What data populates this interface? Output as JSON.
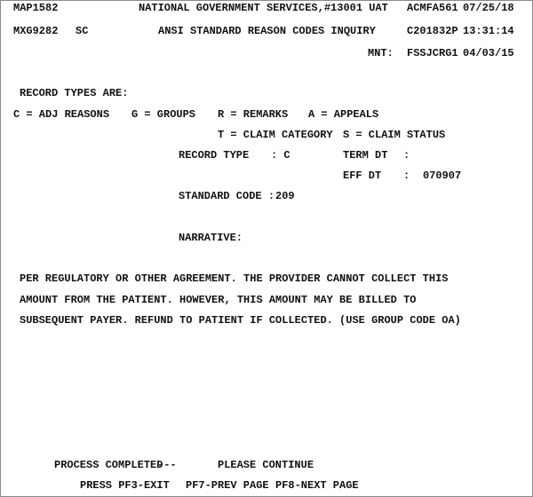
{
  "header": {
    "map_id": "MAP1582",
    "system_title": "NATIONAL GOVERNMENT SERVICES,#13001 UAT",
    "terminal_id": "ACMFA561",
    "date": "07/25/18",
    "screen_id": "MXG9282",
    "screen_code": "SC",
    "screen_title": "ANSI STANDARD REASON CODES INQUIRY",
    "operator_id": "C201832P",
    "time": "13:31:14",
    "mnt_label": "MNT:",
    "mnt_user": "FSSJCRG1",
    "mnt_date": "04/03/15"
  },
  "record_types": {
    "heading": "RECORD TYPES ARE:",
    "c": "C = ADJ REASONS",
    "g": "G = GROUPS",
    "r": "R = REMARKS",
    "a": "A = APPEALS",
    "t": "T = CLAIM CATEGORY",
    "s": "S = CLAIM STATUS"
  },
  "fields": {
    "record_type_label": "RECORD TYPE",
    "record_type_value": ": C",
    "term_dt_label": "TERM DT",
    "term_dt_sep": ":",
    "term_dt_value": "",
    "eff_dt_label": "EFF DT",
    "eff_dt_sep": ":",
    "eff_dt_value": "070907",
    "standard_code_label": "STANDARD CODE :",
    "standard_code_value": "209",
    "narrative_label": "NARRATIVE:"
  },
  "narrative": [
    "PER REGULATORY OR OTHER AGREEMENT. THE PROVIDER CANNOT COLLECT THIS",
    "AMOUNT FROM THE PATIENT. HOWEVER, THIS AMOUNT MAY BE BILLED TO",
    "SUBSEQUENT PAYER. REFUND TO PATIENT IF COLLECTED. (USE GROUP CODE OA)"
  ],
  "footer": {
    "status": "PROCESS COMPLETED",
    "separator": "---",
    "message": "PLEASE CONTINUE",
    "pf3": "PRESS PF3-EXIT",
    "pf7": "PF7-PREV PAGE",
    "pf8": "PF8-NEXT PAGE"
  }
}
